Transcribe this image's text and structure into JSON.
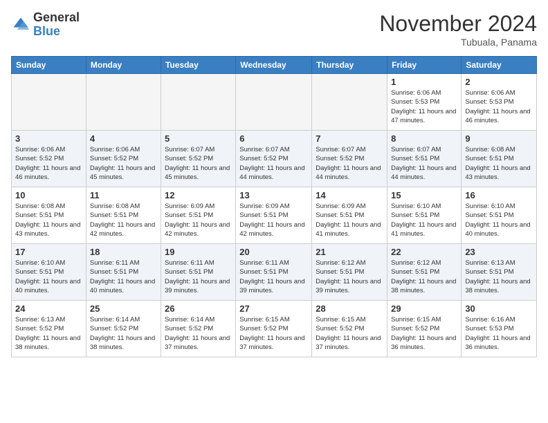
{
  "logo": {
    "general": "General",
    "blue": "Blue"
  },
  "header": {
    "month": "November 2024",
    "location": "Tubuala, Panama"
  },
  "weekdays": [
    "Sunday",
    "Monday",
    "Tuesday",
    "Wednesday",
    "Thursday",
    "Friday",
    "Saturday"
  ],
  "weeks": [
    [
      {
        "day": "",
        "empty": true
      },
      {
        "day": "",
        "empty": true
      },
      {
        "day": "",
        "empty": true
      },
      {
        "day": "",
        "empty": true
      },
      {
        "day": "",
        "empty": true
      },
      {
        "day": "1",
        "sunrise": "6:06 AM",
        "sunset": "5:53 PM",
        "daylight": "11 hours and 47 minutes."
      },
      {
        "day": "2",
        "sunrise": "6:06 AM",
        "sunset": "5:53 PM",
        "daylight": "11 hours and 46 minutes."
      }
    ],
    [
      {
        "day": "3",
        "sunrise": "6:06 AM",
        "sunset": "5:52 PM",
        "daylight": "11 hours and 46 minutes."
      },
      {
        "day": "4",
        "sunrise": "6:06 AM",
        "sunset": "5:52 PM",
        "daylight": "11 hours and 45 minutes."
      },
      {
        "day": "5",
        "sunrise": "6:07 AM",
        "sunset": "5:52 PM",
        "daylight": "11 hours and 45 minutes."
      },
      {
        "day": "6",
        "sunrise": "6:07 AM",
        "sunset": "5:52 PM",
        "daylight": "11 hours and 44 minutes."
      },
      {
        "day": "7",
        "sunrise": "6:07 AM",
        "sunset": "5:52 PM",
        "daylight": "11 hours and 44 minutes."
      },
      {
        "day": "8",
        "sunrise": "6:07 AM",
        "sunset": "5:51 PM",
        "daylight": "11 hours and 44 minutes."
      },
      {
        "day": "9",
        "sunrise": "6:08 AM",
        "sunset": "5:51 PM",
        "daylight": "11 hours and 43 minutes."
      }
    ],
    [
      {
        "day": "10",
        "sunrise": "6:08 AM",
        "sunset": "5:51 PM",
        "daylight": "11 hours and 43 minutes."
      },
      {
        "day": "11",
        "sunrise": "6:08 AM",
        "sunset": "5:51 PM",
        "daylight": "11 hours and 42 minutes."
      },
      {
        "day": "12",
        "sunrise": "6:09 AM",
        "sunset": "5:51 PM",
        "daylight": "11 hours and 42 minutes."
      },
      {
        "day": "13",
        "sunrise": "6:09 AM",
        "sunset": "5:51 PM",
        "daylight": "11 hours and 42 minutes."
      },
      {
        "day": "14",
        "sunrise": "6:09 AM",
        "sunset": "5:51 PM",
        "daylight": "11 hours and 41 minutes."
      },
      {
        "day": "15",
        "sunrise": "6:10 AM",
        "sunset": "5:51 PM",
        "daylight": "11 hours and 41 minutes."
      },
      {
        "day": "16",
        "sunrise": "6:10 AM",
        "sunset": "5:51 PM",
        "daylight": "11 hours and 40 minutes."
      }
    ],
    [
      {
        "day": "17",
        "sunrise": "6:10 AM",
        "sunset": "5:51 PM",
        "daylight": "11 hours and 40 minutes."
      },
      {
        "day": "18",
        "sunrise": "6:11 AM",
        "sunset": "5:51 PM",
        "daylight": "11 hours and 40 minutes."
      },
      {
        "day": "19",
        "sunrise": "6:11 AM",
        "sunset": "5:51 PM",
        "daylight": "11 hours and 39 minutes."
      },
      {
        "day": "20",
        "sunrise": "6:11 AM",
        "sunset": "5:51 PM",
        "daylight": "11 hours and 39 minutes."
      },
      {
        "day": "21",
        "sunrise": "6:12 AM",
        "sunset": "5:51 PM",
        "daylight": "11 hours and 39 minutes."
      },
      {
        "day": "22",
        "sunrise": "6:12 AM",
        "sunset": "5:51 PM",
        "daylight": "11 hours and 38 minutes."
      },
      {
        "day": "23",
        "sunrise": "6:13 AM",
        "sunset": "5:51 PM",
        "daylight": "11 hours and 38 minutes."
      }
    ],
    [
      {
        "day": "24",
        "sunrise": "6:13 AM",
        "sunset": "5:52 PM",
        "daylight": "11 hours and 38 minutes."
      },
      {
        "day": "25",
        "sunrise": "6:14 AM",
        "sunset": "5:52 PM",
        "daylight": "11 hours and 38 minutes."
      },
      {
        "day": "26",
        "sunrise": "6:14 AM",
        "sunset": "5:52 PM",
        "daylight": "11 hours and 37 minutes."
      },
      {
        "day": "27",
        "sunrise": "6:15 AM",
        "sunset": "5:52 PM",
        "daylight": "11 hours and 37 minutes."
      },
      {
        "day": "28",
        "sunrise": "6:15 AM",
        "sunset": "5:52 PM",
        "daylight": "11 hours and 37 minutes."
      },
      {
        "day": "29",
        "sunrise": "6:15 AM",
        "sunset": "5:52 PM",
        "daylight": "11 hours and 36 minutes."
      },
      {
        "day": "30",
        "sunrise": "6:16 AM",
        "sunset": "5:53 PM",
        "daylight": "11 hours and 36 minutes."
      }
    ]
  ]
}
